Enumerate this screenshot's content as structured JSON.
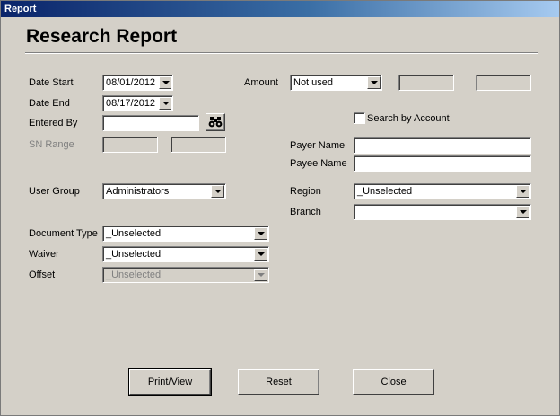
{
  "window": {
    "title": "Report"
  },
  "header": {
    "title": "Research Report"
  },
  "form": {
    "date_start": {
      "label": "Date Start",
      "value": "08/01/2012"
    },
    "date_end": {
      "label": "Date End",
      "value": "08/17/2012"
    },
    "entered_by": {
      "label": "Entered By",
      "value": ""
    },
    "sn_range": {
      "label": "SN Range",
      "from": "",
      "to": ""
    },
    "user_group": {
      "label": "User Group",
      "value": "Administrators"
    },
    "document_type": {
      "label": "Document Type",
      "value": "_Unselected"
    },
    "waiver": {
      "label": "Waiver",
      "value": "_Unselected"
    },
    "offset": {
      "label": "Offset",
      "value": "_Unselected"
    },
    "amount": {
      "label": "Amount",
      "value": "Not used",
      "from": "",
      "to": ""
    },
    "search_by_account": {
      "label": "Search by Account",
      "checked": false
    },
    "payer_name": {
      "label": "Payer Name",
      "value": ""
    },
    "payee_name": {
      "label": "Payee Name",
      "value": ""
    },
    "region": {
      "label": "Region",
      "value": "_Unselected"
    },
    "branch": {
      "label": "Branch",
      "value": ""
    }
  },
  "buttons": {
    "print_view": "Print/View",
    "reset": "Reset",
    "close": "Close"
  },
  "icons": {
    "find": "binoculars-icon",
    "dropdown": "chevron-down-icon"
  }
}
